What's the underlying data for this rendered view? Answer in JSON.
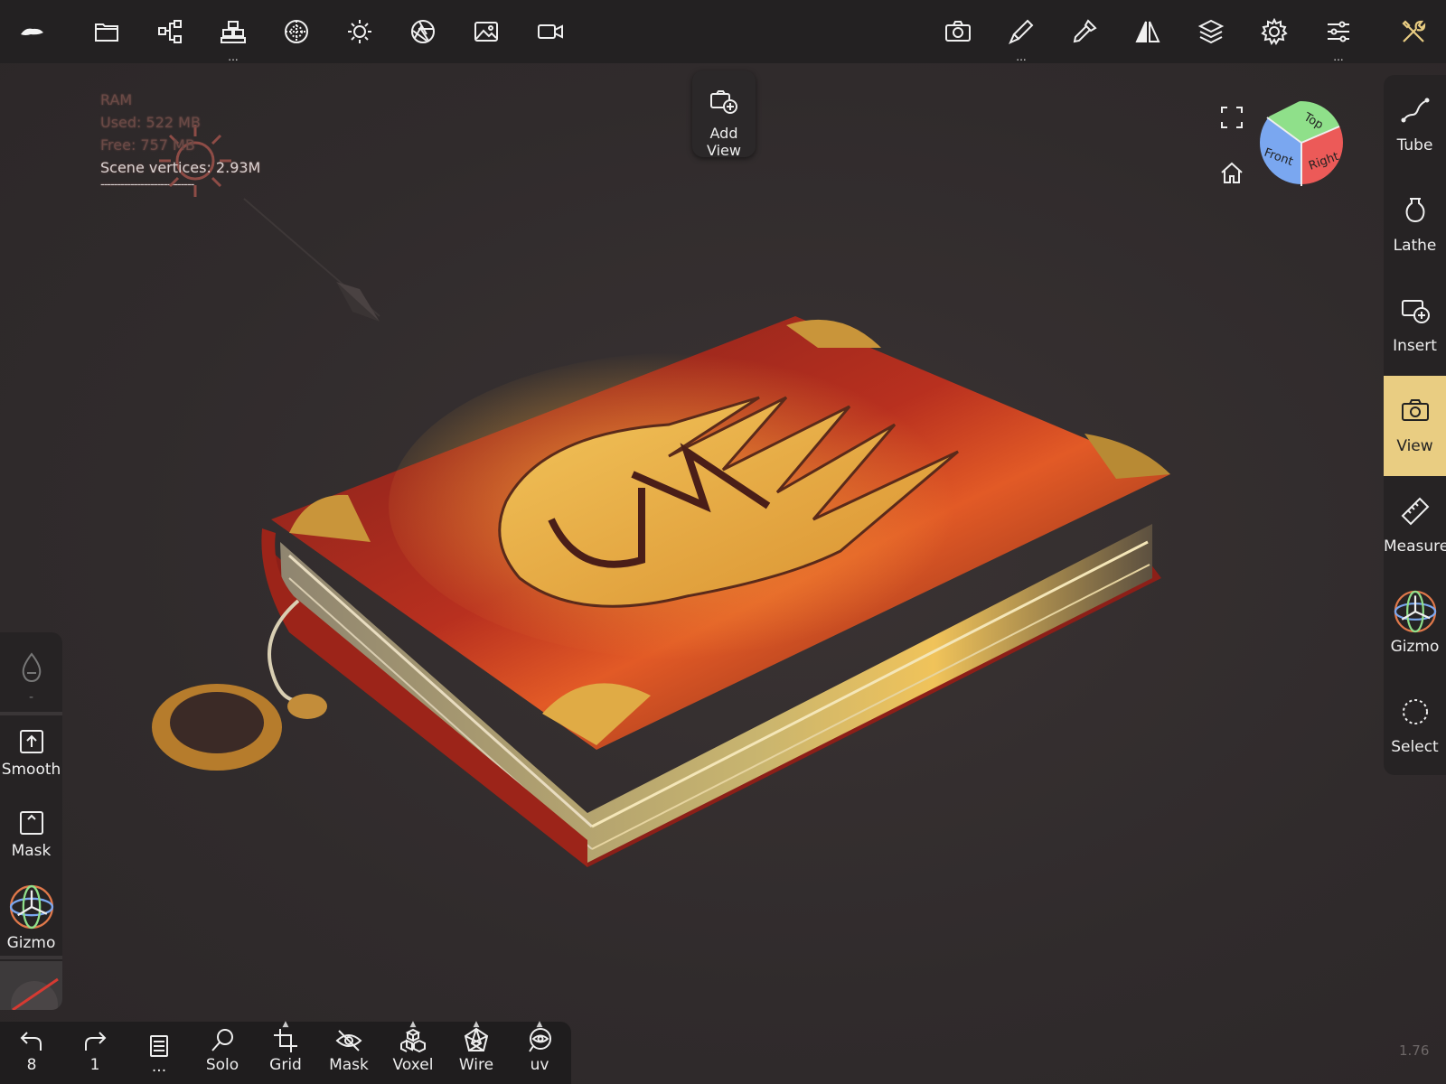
{
  "topbar": {
    "left_icons": [
      "app-logo-icon",
      "folder-icon",
      "scene-graph-icon",
      "topology-icon",
      "material-sphere-icon",
      "light-sun-icon",
      "shading-aperture-icon",
      "background-image-icon",
      "video-camera-icon"
    ],
    "right_icons": [
      "screenshot-camera-icon",
      "brush-icon",
      "color-picker-icon",
      "symmetry-icon",
      "layers-icon",
      "settings-gear-icon",
      "sliders-icon",
      "tools-icon"
    ],
    "topology_dots": "...",
    "brush_dots": "...",
    "sliders_dots": "..."
  },
  "ram": {
    "title": "RAM",
    "used": "Used: 522 MB",
    "free": "Free: 757 MB",
    "vertices": "Scene vertices: 2.93M",
    "separator": "----------------------------"
  },
  "add_view": {
    "label": "Add View"
  },
  "nav_cube": {
    "top": "Top",
    "front": "Front",
    "right": "Right",
    "colors": {
      "top": "#8fe08a",
      "front": "#7aa7f0",
      "right": "#ec5a58"
    }
  },
  "right_panel": {
    "items": [
      {
        "label": "Tube",
        "icon": "tube-curve-icon"
      },
      {
        "label": "Lathe",
        "icon": "lathe-vase-icon"
      },
      {
        "label": "Insert",
        "icon": "insert-icon"
      },
      {
        "label": "View",
        "icon": "view-camera-icon",
        "active": true
      },
      {
        "label": "Measure",
        "icon": "ruler-icon"
      },
      {
        "label": "Gizmo",
        "icon": "gizmo-icon"
      },
      {
        "label": "Select",
        "icon": "select-lasso-icon"
      }
    ],
    "accent": "#e9cd82"
  },
  "left_panel": {
    "dropper_value": "-",
    "items": [
      {
        "label": "Smooth",
        "icon": "smooth-icon"
      },
      {
        "label": "Mask",
        "icon": "mask-icon"
      },
      {
        "label": "Gizmo",
        "icon": "gizmo-icon"
      }
    ]
  },
  "bottombar": {
    "undo_count": "8",
    "redo_count": "1",
    "notes_label": "...",
    "solo": "Solo",
    "grid": "Grid",
    "mask": "Mask",
    "voxel": "Voxel",
    "wire": "Wire",
    "uv": "uv"
  },
  "fps": "1.76"
}
